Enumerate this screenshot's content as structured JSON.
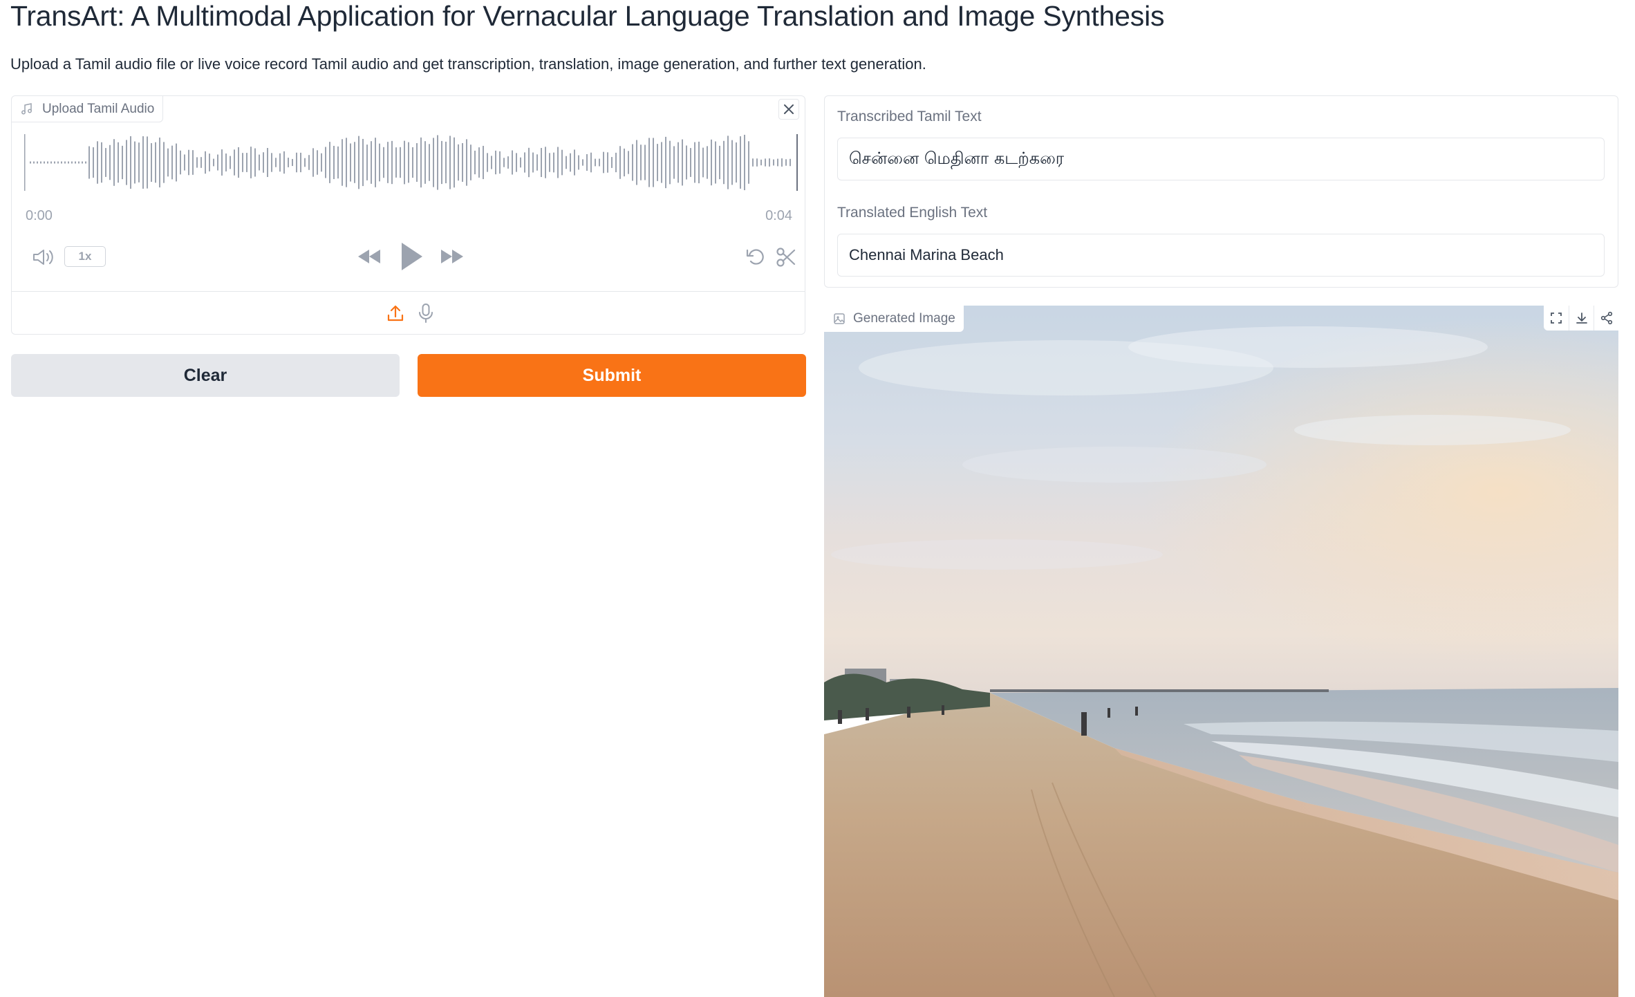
{
  "header": {
    "title": "TransArt: A Multimodal Application for Vernacular Language Translation and Image Synthesis",
    "description": "Upload a Tamil audio file or live voice record Tamil audio and get transcription, translation, image generation, and further text generation."
  },
  "audio_input": {
    "label": "Upload Tamil Audio",
    "label_icon": "music-note-icon",
    "time_start": "0:00",
    "time_end": "0:04",
    "playback_speed": "1x",
    "sources": [
      "upload-icon",
      "microphone-icon"
    ]
  },
  "buttons": {
    "clear_label": "Clear",
    "submit_label": "Submit"
  },
  "outputs": {
    "tamil_label": "Transcribed Tamil Text",
    "tamil_value": "சென்னை மெதினா கடற்கரை",
    "english_label": "Translated English Text",
    "english_value": "Chennai Marina Beach",
    "image_label": "Generated Image",
    "image_label_icon": "image-icon",
    "image_actions": [
      "fullscreen-icon",
      "download-icon",
      "share-icon"
    ]
  },
  "colors": {
    "accent": "#f97316",
    "waveform": "#9ca3af",
    "border": "#e5e7eb"
  }
}
